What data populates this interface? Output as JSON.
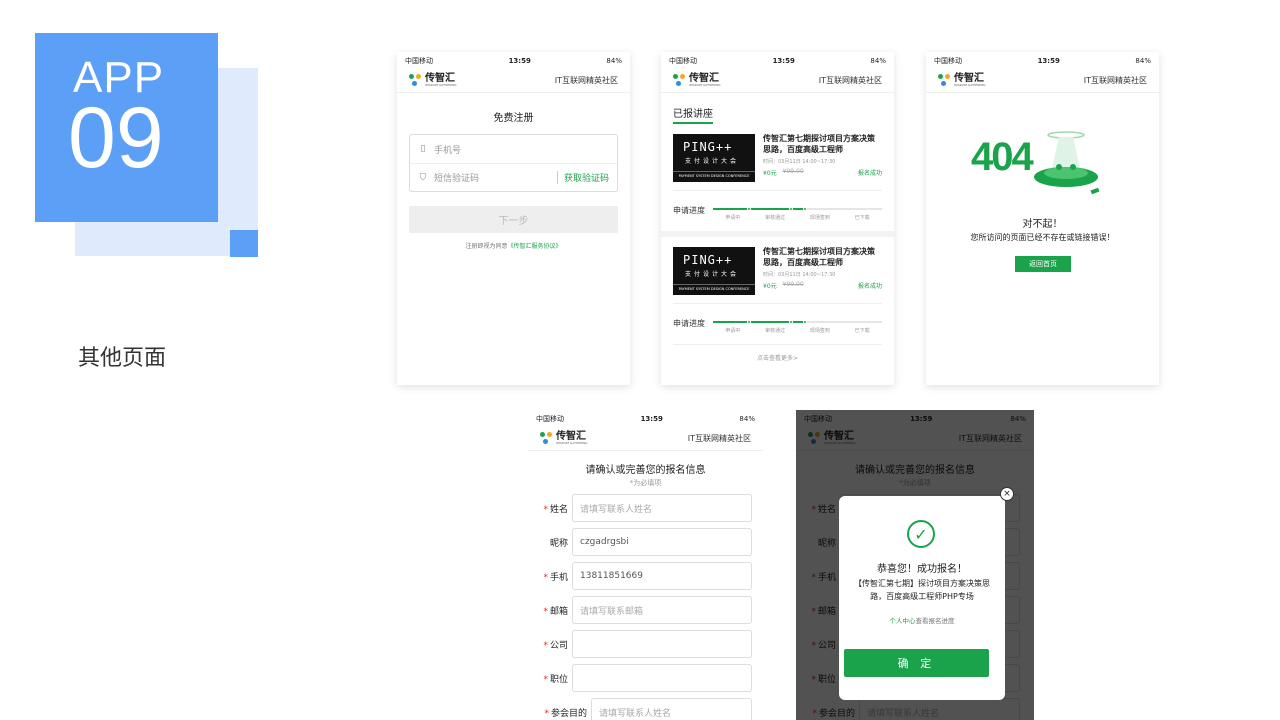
{
  "badge": {
    "app": "APP",
    "number": "09"
  },
  "section_title": "其他页面",
  "status": {
    "carrier": "中国移动",
    "time": "13:59",
    "battery": "84%"
  },
  "header": {
    "logo_cn": "传智汇",
    "logo_en": "WISDOM GATHERING",
    "community": "IT互联网精英社区"
  },
  "register": {
    "title": "免费注册",
    "phone_placeholder": "手机号",
    "code_placeholder": "短信验证码",
    "get_code": "获取验证码",
    "next": "下一步",
    "agree_prefix": "注册即视为同意",
    "agree_link": "《传智汇服务协议》"
  },
  "lectures": {
    "tab": "已报讲座",
    "items": [
      {
        "img_title": "PING++",
        "img_sub": "支付设计大会",
        "img_en": "PAYMENT SYSTEM DESIGN CONFERENCE",
        "title": "传智汇第七期探讨项目方案决策思路，百度高级工程师",
        "time": "时间：03月11日 14:00~17:30",
        "price": "¥0元",
        "old_price": "¥99.00",
        "status": "报名成功"
      },
      {
        "img_title": "PING++",
        "img_sub": "支付设计大会",
        "img_en": "PAYMENT SYSTEM DESIGN CONFERENCE",
        "title": "传智汇第七期探讨项目方案决策思路，百度高级工程师",
        "time": "时间：03月11日 14:00~17:30",
        "price": "¥0元",
        "old_price": "¥99.00",
        "status": "报名成功"
      }
    ],
    "progress_label": "申请进度",
    "progress_fraction": 0.55,
    "steps": [
      "申请中",
      "审核通过",
      "现场签到",
      "已下载"
    ],
    "more": "点击查看更多>"
  },
  "notfound": {
    "code": "404",
    "sorry": "对不起！",
    "message": "您所访问的页面已经不存在或链接错误！",
    "home": "返回首页"
  },
  "form": {
    "title": "请确认或完善您的报名信息",
    "required_note": "*为必填项",
    "fields": [
      {
        "label": "姓名",
        "required": true,
        "value": "",
        "placeholder": "请填写联系人姓名"
      },
      {
        "label": "昵称",
        "required": false,
        "value": "czgadrgsbi",
        "placeholder": ""
      },
      {
        "label": "手机",
        "required": true,
        "value": "13811851669",
        "placeholder": ""
      },
      {
        "label": "邮箱",
        "required": true,
        "value": "",
        "placeholder": "请填写联系邮箱"
      },
      {
        "label": "公司",
        "required": true,
        "value": "",
        "placeholder": ""
      },
      {
        "label": "职位",
        "required": true,
        "value": "",
        "placeholder": ""
      },
      {
        "label": "参会目的",
        "required": true,
        "value": "",
        "placeholder": "请填写联系人姓名"
      }
    ]
  },
  "modal": {
    "heading": "恭喜您！成功报名！",
    "desc": "【传智汇第七期】探讨项目方案决策思路，百度高级工程师PHP专场",
    "link_text": "个人中心",
    "link_suffix": "查看报名进度",
    "ok": "确 定",
    "close": "×"
  },
  "colors": {
    "accent": "#1ba34b",
    "badge_blue": "#5b9ff6",
    "badge_light": "#dfeafc"
  }
}
